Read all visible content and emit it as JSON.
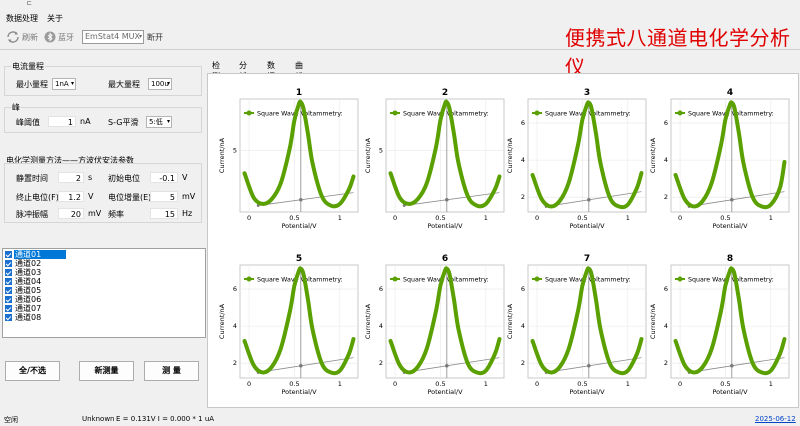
{
  "window": {
    "top_glyph": "ᄃ"
  },
  "menu": {
    "items": [
      "数据处理",
      "关于"
    ]
  },
  "toolbar": {
    "refresh_label": "刷新",
    "bluetooth_label": "蓝牙",
    "device_value": "EmStat4 MUX",
    "disconnect_label": "断开"
  },
  "app_title": "便携式八通道电化学分析仪",
  "current_range": {
    "title": "电流量程",
    "min_label": "最小量程",
    "min_value": "1nA",
    "max_label": "最大量程",
    "max_value": "100u"
  },
  "peak": {
    "title": "峰",
    "threshold_label": "峰阈值",
    "threshold_value": "1",
    "threshold_unit": "nA",
    "smooth_label": "S-G平滑",
    "smooth_value": "5:低"
  },
  "method": {
    "title": "电化学测量方法——方波伏安法参数",
    "rest_time_label": "静置时间",
    "rest_time_value": "2",
    "rest_time_unit": "s",
    "init_potential_label": "初始电位",
    "init_potential_value": "-0.1",
    "init_potential_unit": "V",
    "end_potential_label": "终止电位(F)",
    "end_potential_value": "1.2",
    "end_potential_unit": "V",
    "step_label": "电位增量(E)",
    "step_value": "5",
    "step_unit": "mV",
    "pulse_label": "脉冲振幅",
    "pulse_value": "20",
    "pulse_unit": "mV",
    "freq_label": "频率",
    "freq_value": "15",
    "freq_unit": "Hz"
  },
  "channels": [
    "通道01",
    "通道02",
    "通道03",
    "通道04",
    "通道05",
    "通道06",
    "通道07",
    "通道08"
  ],
  "buttons": {
    "select_all": "全/不选",
    "new_measure": "新测量",
    "measure": "测  量"
  },
  "tabs": [
    "检测",
    "分析",
    "数据",
    "曲线"
  ],
  "status": {
    "state": "空闲",
    "device": "Unknown",
    "readout": "E = 0.131V   I = 0.000 * 1 uA",
    "date": "2025-06-12"
  },
  "colors": {
    "series": "#5aa000",
    "title": "#e00000",
    "selection": "#0078d7"
  },
  "chart_data": [
    {
      "type": "line",
      "title": "1",
      "legend": "Square Wave Voltammetry:",
      "xlabel": "Potential/V",
      "ylabel": "Current/nA",
      "xlim": [
        -0.1,
        1.2
      ],
      "ylim": [
        1.2,
        8.2
      ],
      "xticks": [
        0,
        0.5,
        1
      ],
      "yticks": [
        5
      ],
      "peak_x": 0.57,
      "x": [
        -0.05,
        0.05,
        0.15,
        0.25,
        0.35,
        0.45,
        0.5,
        0.55,
        0.57,
        0.6,
        0.65,
        0.7,
        0.8,
        0.9,
        1.0,
        1.1,
        1.15
      ],
      "y": [
        3.6,
        2.1,
        1.7,
        2.0,
        3.0,
        5.2,
        6.9,
        7.9,
        8.0,
        7.6,
        6.0,
        4.2,
        2.2,
        1.6,
        1.7,
        2.6,
        3.4
      ],
      "baseline": [
        [
          0.1,
          1.6
        ],
        [
          1.15,
          2.4
        ]
      ]
    },
    {
      "type": "line",
      "title": "2",
      "legend": "Square Wave Voltammetry:",
      "xlabel": "Potential/V",
      "ylabel": "Current/nA",
      "xlim": [
        -0.1,
        1.2
      ],
      "ylim": [
        1.2,
        8.2
      ],
      "xticks": [
        0,
        0.5,
        1
      ],
      "yticks": [
        5
      ],
      "peak_x": 0.57,
      "x": [
        -0.05,
        0.05,
        0.15,
        0.25,
        0.35,
        0.45,
        0.5,
        0.55,
        0.57,
        0.6,
        0.65,
        0.7,
        0.8,
        0.9,
        1.0,
        1.1,
        1.15
      ],
      "y": [
        3.6,
        2.1,
        1.7,
        2.0,
        3.0,
        5.2,
        6.9,
        7.9,
        8.0,
        7.6,
        6.0,
        4.2,
        2.2,
        1.6,
        1.7,
        2.6,
        3.4
      ],
      "baseline": [
        [
          0.1,
          1.6
        ],
        [
          1.15,
          2.4
        ]
      ]
    },
    {
      "type": "line",
      "title": "3",
      "legend": "Square Wave Voltammetry:",
      "xlabel": "Potential/V",
      "ylabel": "Current/nA",
      "xlim": [
        -0.1,
        1.2
      ],
      "ylim": [
        1.2,
        7.3
      ],
      "xticks": [
        0,
        0.5,
        1
      ],
      "yticks": [
        2,
        4,
        6
      ],
      "peak_x": 0.57,
      "x": [
        -0.05,
        0.05,
        0.15,
        0.25,
        0.35,
        0.45,
        0.5,
        0.55,
        0.57,
        0.6,
        0.65,
        0.7,
        0.8,
        0.9,
        1.0,
        1.1,
        1.15
      ],
      "y": [
        3.2,
        1.9,
        1.5,
        1.8,
        2.8,
        4.8,
        6.2,
        7.0,
        7.1,
        6.8,
        5.4,
        3.8,
        2.0,
        1.5,
        1.6,
        2.5,
        3.3
      ],
      "baseline": [
        [
          0.1,
          1.5
        ],
        [
          1.15,
          2.3
        ]
      ]
    },
    {
      "type": "line",
      "title": "4",
      "legend": "Square Wave Voltammetry:",
      "xlabel": "Potential/V",
      "ylabel": "Current/nA",
      "xlim": [
        -0.1,
        1.2
      ],
      "ylim": [
        1.2,
        7.3
      ],
      "xticks": [
        0,
        0.5,
        1
      ],
      "yticks": [
        2,
        4,
        6
      ],
      "peak_x": 0.57,
      "x": [
        -0.05,
        0.05,
        0.15,
        0.25,
        0.35,
        0.45,
        0.5,
        0.55,
        0.57,
        0.6,
        0.65,
        0.7,
        0.8,
        0.9,
        1.0,
        1.1,
        1.15
      ],
      "y": [
        3.2,
        1.9,
        1.5,
        1.8,
        2.8,
        4.8,
        6.2,
        7.0,
        7.1,
        6.8,
        5.4,
        3.8,
        2.0,
        1.5,
        1.6,
        2.5,
        3.9
      ],
      "baseline": [
        [
          0.1,
          1.5
        ],
        [
          1.15,
          2.3
        ]
      ]
    },
    {
      "type": "line",
      "title": "5",
      "legend": "Square Wave Voltammetry:",
      "xlabel": "Potential/V",
      "ylabel": "Current/nA",
      "xlim": [
        -0.1,
        1.2
      ],
      "ylim": [
        1.2,
        7.3
      ],
      "xticks": [
        0,
        0.5,
        1
      ],
      "yticks": [
        2,
        4,
        6
      ],
      "peak_x": 0.57,
      "x": [
        -0.05,
        0.05,
        0.15,
        0.25,
        0.35,
        0.45,
        0.5,
        0.55,
        0.57,
        0.6,
        0.65,
        0.7,
        0.8,
        0.9,
        1.0,
        1.1,
        1.15
      ],
      "y": [
        3.2,
        1.9,
        1.5,
        1.8,
        2.8,
        4.8,
        6.2,
        7.0,
        7.1,
        6.8,
        5.4,
        3.8,
        2.0,
        1.5,
        1.6,
        2.5,
        3.3
      ],
      "baseline": [
        [
          0.1,
          1.5
        ],
        [
          1.15,
          2.3
        ]
      ]
    },
    {
      "type": "line",
      "title": "6",
      "legend": "Square Wave Voltammetry:",
      "xlabel": "Potential/V",
      "ylabel": "Current/nA",
      "xlim": [
        -0.1,
        1.2
      ],
      "ylim": [
        1.2,
        7.3
      ],
      "xticks": [
        0,
        0.5,
        1
      ],
      "yticks": [
        2,
        4,
        6
      ],
      "peak_x": 0.57,
      "x": [
        -0.05,
        0.05,
        0.15,
        0.25,
        0.35,
        0.45,
        0.5,
        0.55,
        0.57,
        0.6,
        0.65,
        0.7,
        0.8,
        0.9,
        1.0,
        1.1,
        1.15
      ],
      "y": [
        3.2,
        1.9,
        1.5,
        1.8,
        2.8,
        4.8,
        6.2,
        7.0,
        7.1,
        6.8,
        5.4,
        3.8,
        2.0,
        1.5,
        1.6,
        2.5,
        3.3
      ],
      "baseline": [
        [
          0.1,
          1.5
        ],
        [
          1.15,
          2.3
        ]
      ]
    },
    {
      "type": "line",
      "title": "7",
      "legend": "Square Wave Voltammetry:",
      "xlabel": "Potential/V",
      "ylabel": "Current/nA",
      "xlim": [
        -0.1,
        1.2
      ],
      "ylim": [
        1.2,
        7.3
      ],
      "xticks": [
        0,
        0.5,
        1
      ],
      "yticks": [
        2,
        4,
        6
      ],
      "peak_x": 0.57,
      "x": [
        -0.05,
        0.05,
        0.15,
        0.25,
        0.35,
        0.45,
        0.5,
        0.55,
        0.57,
        0.6,
        0.65,
        0.7,
        0.8,
        0.9,
        1.0,
        1.1,
        1.15
      ],
      "y": [
        3.2,
        1.9,
        1.5,
        1.8,
        2.8,
        4.8,
        6.2,
        7.0,
        7.1,
        6.8,
        5.4,
        3.8,
        2.0,
        1.5,
        1.6,
        2.5,
        3.3
      ],
      "baseline": [
        [
          0.1,
          1.5
        ],
        [
          1.15,
          2.3
        ]
      ]
    },
    {
      "type": "line",
      "title": "8",
      "legend": "Square Wave Voltammetry:",
      "xlabel": "Potential/V",
      "ylabel": "Current/nA",
      "xlim": [
        -0.1,
        1.2
      ],
      "ylim": [
        1.2,
        7.3
      ],
      "xticks": [
        0,
        0.5,
        1
      ],
      "yticks": [
        2,
        4,
        6
      ],
      "peak_x": 0.57,
      "x": [
        -0.05,
        0.05,
        0.15,
        0.25,
        0.35,
        0.45,
        0.5,
        0.55,
        0.57,
        0.6,
        0.65,
        0.7,
        0.8,
        0.9,
        1.0,
        1.1,
        1.15
      ],
      "y": [
        3.2,
        1.9,
        1.5,
        1.8,
        2.8,
        4.8,
        6.2,
        7.0,
        7.1,
        6.8,
        5.4,
        3.8,
        2.0,
        1.5,
        1.6,
        2.5,
        3.3
      ],
      "baseline": [
        [
          0.1,
          1.5
        ],
        [
          1.15,
          2.3
        ]
      ]
    }
  ]
}
